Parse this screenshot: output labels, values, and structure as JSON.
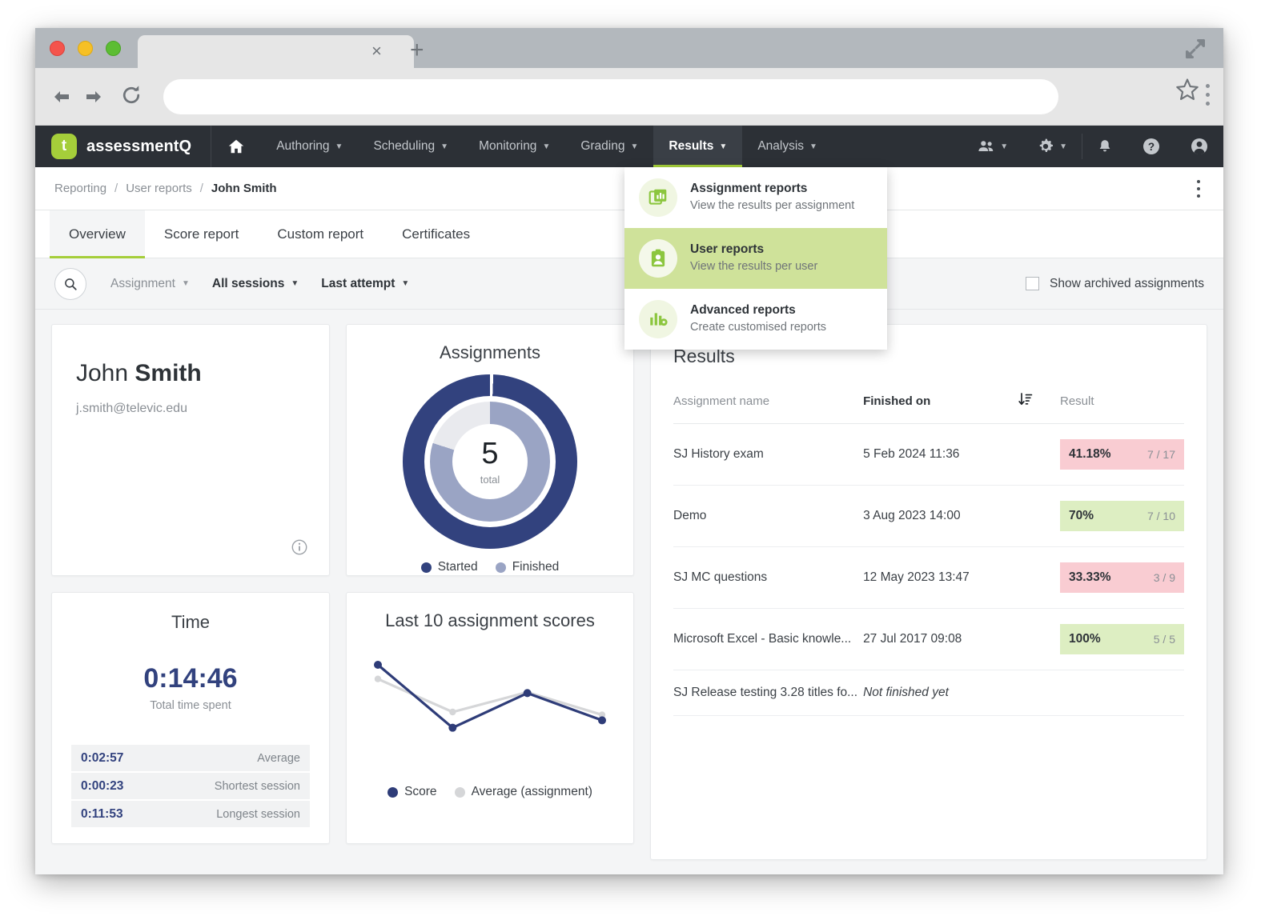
{
  "browser": {
    "tab_title": "",
    "url_value": "",
    "icons": {
      "back": "back-arrow-icon",
      "forward": "forward-arrow-icon",
      "reload": "reload-icon",
      "bookmark": "star-icon",
      "menu": "browser-menu-icon",
      "new_tab": "+",
      "close_tab": "×",
      "maximize": "maximize-icon"
    }
  },
  "topnav": {
    "brand_mark": "t",
    "brand_name": "assessmentQ",
    "items": [
      {
        "label": "",
        "icon": "home-icon",
        "caret": false,
        "active": false
      },
      {
        "label": "Authoring",
        "caret": true,
        "active": false
      },
      {
        "label": "Scheduling",
        "caret": true,
        "active": false
      },
      {
        "label": "Monitoring",
        "caret": true,
        "active": false
      },
      {
        "label": "Grading",
        "caret": true,
        "active": false
      },
      {
        "label": "Results",
        "caret": true,
        "active": true
      },
      {
        "label": "Analysis",
        "caret": true,
        "active": false
      }
    ],
    "right_icons": [
      {
        "name": "users-icon",
        "caret": true
      },
      {
        "name": "gear-icon",
        "caret": true
      },
      {
        "name": "bell-icon",
        "caret": false
      },
      {
        "name": "help-icon",
        "caret": false
      },
      {
        "name": "account-icon",
        "caret": false
      }
    ],
    "accent_color": "#a5ce3a",
    "bar_color": "#2c3036"
  },
  "dropdown": {
    "open": true,
    "items": [
      {
        "icon": "assignment-reports-icon",
        "title": "Assignment reports",
        "subtitle": "View the results per assignment",
        "highlighted": false
      },
      {
        "icon": "user-reports-icon",
        "title": "User reports",
        "subtitle": "View the results per user",
        "highlighted": true
      },
      {
        "icon": "advanced-reports-icon",
        "title": "Advanced reports",
        "subtitle": "Create customised reports",
        "highlighted": false
      }
    ]
  },
  "breadcrumb": {
    "items": [
      "Reporting",
      "User reports",
      "John Smith"
    ],
    "separator": "/"
  },
  "tabs": [
    {
      "label": "Overview",
      "active": true
    },
    {
      "label": "Score report",
      "active": false
    },
    {
      "label": "Custom report",
      "active": false
    },
    {
      "label": "Certificates",
      "active": false
    }
  ],
  "filters": {
    "search_icon": "search-icon",
    "chips": [
      {
        "label": "Assignment",
        "bold": false
      },
      {
        "label": "All sessions",
        "bold": true
      },
      {
        "label": "Last attempt",
        "bold": true
      }
    ],
    "archived_label": "Show archived assignments",
    "archived_checked": false
  },
  "user_card": {
    "first_name": "John",
    "last_name": "Smith",
    "email": "j.smith@televic.edu",
    "info_icon": "info-icon"
  },
  "time_card": {
    "title": "Time",
    "total": "0:14:46",
    "total_label": "Total time spent",
    "rows": [
      {
        "value": "0:02:57",
        "label": "Average"
      },
      {
        "value": "0:00:23",
        "label": "Shortest session"
      },
      {
        "value": "0:11:53",
        "label": "Longest session"
      }
    ]
  },
  "results_panel": {
    "title": "Results",
    "columns": [
      "Assignment name",
      "Finished on",
      "Result"
    ],
    "sort_icon": "sort-descending-icon",
    "rows": [
      {
        "name": "SJ History exam",
        "finished_on": "5 Feb 2024 11:36",
        "percent": "41.18%",
        "fraction": "7 / 17",
        "status": "fail"
      },
      {
        "name": "Demo",
        "finished_on": "3 Aug 2023 14:00",
        "percent": "70%",
        "fraction": "7 / 10",
        "status": "pass"
      },
      {
        "name": "SJ MC questions",
        "finished_on": "12 May 2023 13:47",
        "percent": "33.33%",
        "fraction": "3 / 9",
        "status": "fail"
      },
      {
        "name": "Microsoft Excel - Basic knowle...",
        "finished_on": "27 Jul 2017 09:08",
        "percent": "100%",
        "fraction": "5 / 5",
        "status": "pass"
      },
      {
        "name": "SJ Release testing 3.28 titles fo...",
        "finished_on": "Not finished yet",
        "percent": "",
        "fraction": "",
        "status": "none"
      }
    ],
    "pass_color": "#ddeec2",
    "fail_color": "#f9ccd2"
  },
  "chart_data": [
    {
      "type": "pie",
      "title": "Assignments",
      "center_value": "5",
      "center_label": "total",
      "rings": [
        {
          "name": "Started",
          "value": 5,
          "total": 5,
          "fraction": 0.994,
          "color": "#32427e"
        },
        {
          "name": "Finished",
          "value": 4,
          "total": 5,
          "fraction": 0.8,
          "color": "#9aa4c4"
        }
      ],
      "legend": [
        {
          "label": "Started",
          "color": "#32427e"
        },
        {
          "label": "Finished",
          "color": "#9aa4c4"
        }
      ],
      "legend_position": "bottom"
    },
    {
      "type": "line",
      "title": "Last 10 assignment scores",
      "x": [
        1,
        2,
        3,
        4
      ],
      "series": [
        {
          "name": "Score",
          "color": "#2e3c78",
          "values": [
            100,
            33.33,
            70,
            41.18
          ]
        },
        {
          "name": "Average (assignment)",
          "color": "#d5d6d8",
          "values": [
            85,
            50,
            71,
            47
          ]
        }
      ],
      "xlabel": "",
      "ylabel": "",
      "ylim": [
        0,
        100
      ],
      "grid": false,
      "legend": [
        {
          "label": "Score",
          "color": "#2e3c78"
        },
        {
          "label": "Average (assignment)",
          "color": "#d5d6d8"
        }
      ],
      "legend_position": "bottom"
    }
  ]
}
